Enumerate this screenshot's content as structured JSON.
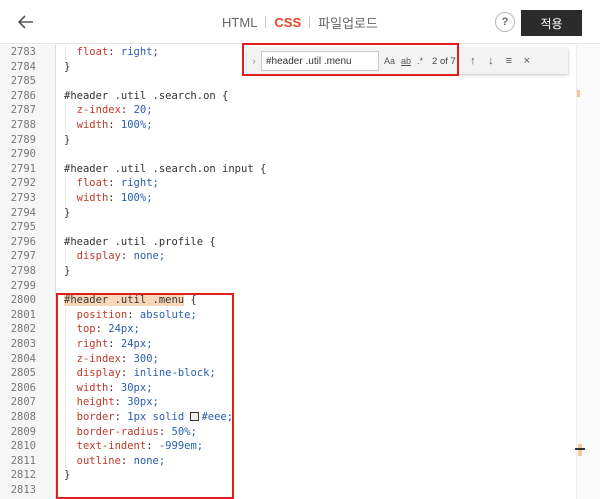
{
  "header": {
    "tabs": [
      {
        "label": "HTML",
        "active": false
      },
      {
        "label": "CSS",
        "active": true
      },
      {
        "label": "파일업로드",
        "active": false
      }
    ],
    "help_label": "?",
    "apply_label": "적용"
  },
  "find": {
    "query": "#header .util .menu",
    "opt_case": "Aa",
    "opt_word": "ab",
    "opt_regex": ".*",
    "count": "2 of 7"
  },
  "lines": [
    {
      "n": "2783",
      "code": "  float: right;"
    },
    {
      "n": "2784",
      "code": "}"
    },
    {
      "n": "2785",
      "code": ""
    },
    {
      "n": "2786",
      "code": "#header .util .search.on {"
    },
    {
      "n": "2787",
      "code": "  z-index: 20;"
    },
    {
      "n": "2788",
      "code": "  width: 100%;"
    },
    {
      "n": "2789",
      "code": "}"
    },
    {
      "n": "2790",
      "code": ""
    },
    {
      "n": "2791",
      "code": "#header .util .search.on input {"
    },
    {
      "n": "2792",
      "code": "  float: right;"
    },
    {
      "n": "2793",
      "code": "  width: 100%;"
    },
    {
      "n": "2794",
      "code": "}"
    },
    {
      "n": "2795",
      "code": ""
    },
    {
      "n": "2796",
      "code": "#header .util .profile {"
    },
    {
      "n": "2797",
      "code": "  display: none;"
    },
    {
      "n": "2798",
      "code": "}"
    },
    {
      "n": "2799",
      "code": ""
    },
    {
      "n": "2800",
      "code": "#header .util .menu {"
    },
    {
      "n": "2801",
      "code": "  position: absolute;"
    },
    {
      "n": "2802",
      "code": "  top: 24px;"
    },
    {
      "n": "2803",
      "code": "  right: 24px;"
    },
    {
      "n": "2804",
      "code": "  z-index: 300;"
    },
    {
      "n": "2805",
      "code": "  display: inline-block;"
    },
    {
      "n": "2806",
      "code": "  width: 30px;"
    },
    {
      "n": "2807",
      "code": "  height: 30px;"
    },
    {
      "n": "2808",
      "code": "  border: 1px solid #eee;"
    },
    {
      "n": "2809",
      "code": "  border-radius: 50%;"
    },
    {
      "n": "2810",
      "code": "  text-indent: -999em;"
    },
    {
      "n": "2811",
      "code": "  outline: none;"
    },
    {
      "n": "2812",
      "code": "}"
    },
    {
      "n": "2813",
      "code": ""
    }
  ],
  "highlight_line": "2800",
  "colors": {
    "accent": "#e8452c",
    "apply_bg": "#2b2b2b",
    "annotation": "#e01e1e",
    "match_highlight": "#f8d7b8",
    "property": "#c0392b",
    "value": "#2a5db0"
  },
  "icons": {
    "back": "arrow-left-icon",
    "find_toggle": "chevron-right-icon",
    "prev": "arrow-up-icon",
    "next": "arrow-down-icon",
    "in_selection": "lines-icon",
    "close": "close-icon"
  }
}
